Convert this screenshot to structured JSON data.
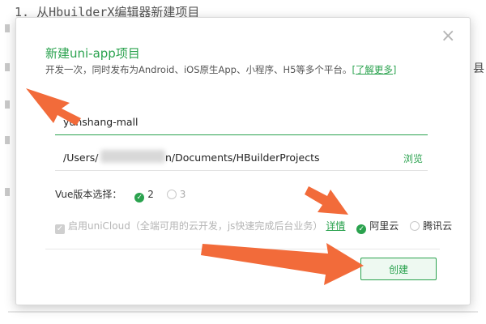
{
  "background": {
    "doc_heading": "1. 从HbuilderX编辑器新建项目",
    "right_fragment": "县"
  },
  "dialog": {
    "title": "新建uni-app项目",
    "subtitle": "开发一次，同时发布为Android、iOS原生App、小程序、H5等多个平台。",
    "learn_more": "[了解更多]",
    "close_icon": "×",
    "project_name": "yunshang-mall",
    "path_prefix": "/Users/",
    "path_suffix": "n/Documents/HBuilderProjects",
    "browse_label": "浏览",
    "vue_label": "Vue版本选择：",
    "vue_options": [
      {
        "label": "2",
        "selected": true
      },
      {
        "label": "3",
        "selected": false
      }
    ],
    "unicloud_label": "启用uniCloud（全端可用的云开发，js快速完成后台业务）",
    "detail_label": "详情",
    "providers": [
      {
        "label": "阿里云",
        "selected": true
      },
      {
        "label": "腾讯云",
        "selected": false
      }
    ],
    "create_label": "创建"
  },
  "colors": {
    "accent": "#2aa24e",
    "arrow": "#f26b3a"
  }
}
